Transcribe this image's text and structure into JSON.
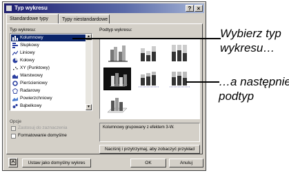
{
  "dialog": {
    "title": "Typ wykresu",
    "help_button": "?",
    "close_button": "×",
    "tabs": [
      "Standardowe typy",
      "Typy niestandardowe"
    ],
    "chart_type_label": "Typ wykresu:",
    "subtype_label": "Podtyp wykresu:",
    "chart_types": [
      {
        "label": "Kolumnowy",
        "icon": "column-chart-icon",
        "selected": true
      },
      {
        "label": "Słupkowy",
        "icon": "bar-chart-icon"
      },
      {
        "label": "Liniowy",
        "icon": "line-chart-icon"
      },
      {
        "label": "Kołowy",
        "icon": "pie-chart-icon"
      },
      {
        "label": "XY (Punktowy)",
        "icon": "scatter-chart-icon"
      },
      {
        "label": "Warstwowy",
        "icon": "area-chart-icon"
      },
      {
        "label": "Pierścieniowy",
        "icon": "doughnut-chart-icon"
      },
      {
        "label": "Radarowy",
        "icon": "radar-chart-icon"
      },
      {
        "label": "Powierzchniowy",
        "icon": "surface-chart-icon"
      },
      {
        "label": "Bąbelkowy",
        "icon": "bubble-chart-icon"
      }
    ],
    "options_label": "Opcje",
    "option_apply_to_selection": "Zastosuj do zaznaczenia",
    "option_default_formatting": "Formatowanie domyślne",
    "subtype_description": "Kolumnowy grupowany z efektem 3-W.",
    "press_hold_button": "Naciśnij i przytrzymaj, aby zobaczyć przykład",
    "set_default_button": "Ustaw jako domyślny wykres",
    "ok_button": "OK",
    "cancel_button": "Anuluj"
  },
  "annotations": {
    "callout_1": [
      "Wybierz typ",
      "wykresu…"
    ],
    "callout_2": [
      "…a następnie",
      "podtyp"
    ]
  },
  "colors": {
    "selection": "#0a246a",
    "dialog_bg": "#d4d0c8",
    "titlebar": "#1d1d6f"
  }
}
